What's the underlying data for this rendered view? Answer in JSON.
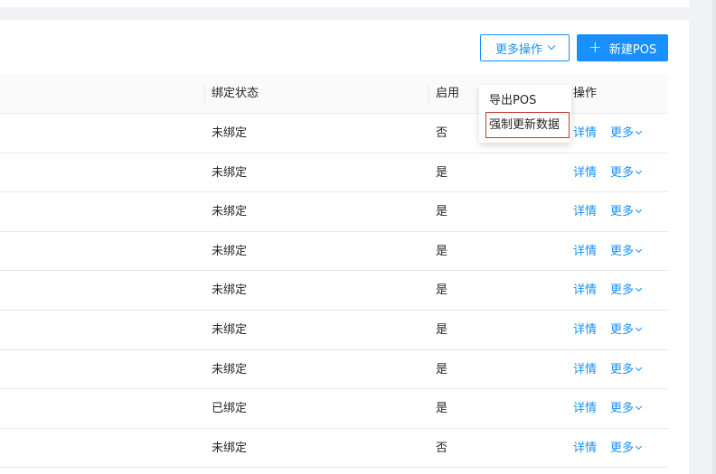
{
  "toolbar": {
    "more_actions_label": "更多操作",
    "new_pos_label": "新建POS"
  },
  "table": {
    "headers": {
      "bind_status": "绑定状态",
      "enabled": "启用",
      "actions": "操作"
    },
    "rows": [
      {
        "bind_status": "未绑定",
        "enabled": "否",
        "detail": "详情",
        "more": "更多"
      },
      {
        "bind_status": "未绑定",
        "enabled": "是",
        "detail": "详情",
        "more": "更多"
      },
      {
        "bind_status": "未绑定",
        "enabled": "是",
        "detail": "详情",
        "more": "更多"
      },
      {
        "bind_status": "未绑定",
        "enabled": "是",
        "detail": "详情",
        "more": "更多"
      },
      {
        "bind_status": "未绑定",
        "enabled": "是",
        "detail": "详情",
        "more": "更多"
      },
      {
        "bind_status": "未绑定",
        "enabled": "是",
        "detail": "详情",
        "more": "更多"
      },
      {
        "bind_status": "未绑定",
        "enabled": "是",
        "detail": "详情",
        "more": "更多"
      },
      {
        "bind_status": "已绑定",
        "enabled": "是",
        "detail": "详情",
        "more": "更多"
      },
      {
        "bind_status": "未绑定",
        "enabled": "否",
        "detail": "详情",
        "more": "更多"
      }
    ]
  },
  "dropdown": {
    "items": [
      {
        "label": "导出POS"
      },
      {
        "label": "强制更新数据"
      }
    ]
  },
  "colors": {
    "primary": "#1890ff",
    "highlight_border": "#c0392b"
  }
}
